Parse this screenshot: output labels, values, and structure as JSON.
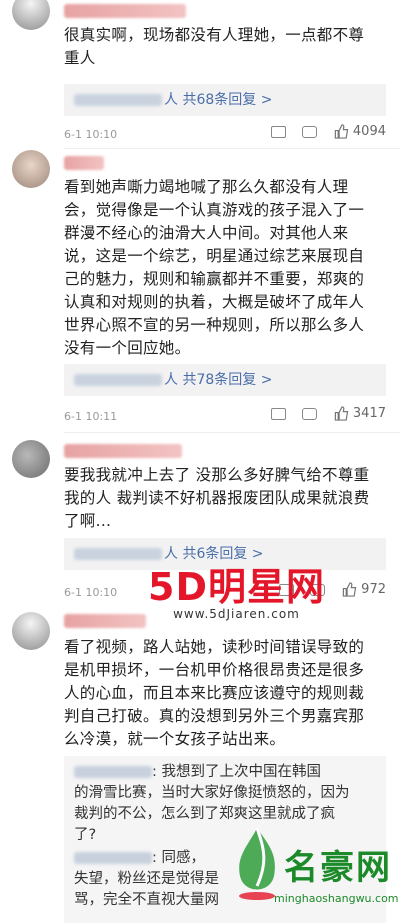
{
  "comments": [
    {
      "text": "很真实啊，现场都没有人理她，一点都不尊\n重人",
      "reply_label": "人 共68条回复 >",
      "date": "6-1 10:10",
      "likes": "4094"
    },
    {
      "text": "看到她声嘶力竭地喊了那么久都没有人理\n会，觉得像是一个认真游戏的孩子混入了一\n群漫不经心的油滑大人中间。对其他人来\n说，这是一个综艺，明星通过综艺来展现自\n己的魅力，规则和输赢都并不重要，郑爽的\n认真和对规则的执着，大概是破坏了成年人\n世界心照不宣的另一种规则，所以那么多人\n没有一个回应她。",
      "reply_label": "人 共78条回复 >",
      "date": "6-1 10:11",
      "likes": "3417"
    },
    {
      "text": "要我我就冲上去了 没那么多好脾气给不尊重\n我的人 裁判读不好机器报废团队成果就浪费\n了啊...",
      "reply_label": "人 共6条回复 >",
      "date": "6-1 10:10",
      "likes": "972"
    },
    {
      "text": "看了视频，路人站她，读秒时间错误导致的\n是机甲损坏，一台机甲价格很昂贵还是很多\n人的心血，而且本来比赛应该遵守的规则裁\n判自己打破。真的没想到另外三个男嘉宾那\n么冷漠，就一个女孩子站出来。",
      "sub_replies": [
        ": 我想到了上次中国在韩国\n的滑雪比赛，当时大家好像挺愤怒的，因为\n裁判的不公，怎么到了郑爽这里就成了疯\n了?",
        ": 同感，\n失望，粉丝还是觉得是\n骂，完全不直视大量网"
      ]
    }
  ],
  "watermarks": {
    "site_a_name": "5D明星网",
    "site_a_url": "www.5dJiaren.com",
    "site_b_name": "名豪网",
    "site_b_url": "minghaoshangwu.com"
  },
  "colors": {
    "accent_link": "#4a6ea8",
    "watermark_red": "#e4162a",
    "logo_green": "#1d8a2a"
  }
}
